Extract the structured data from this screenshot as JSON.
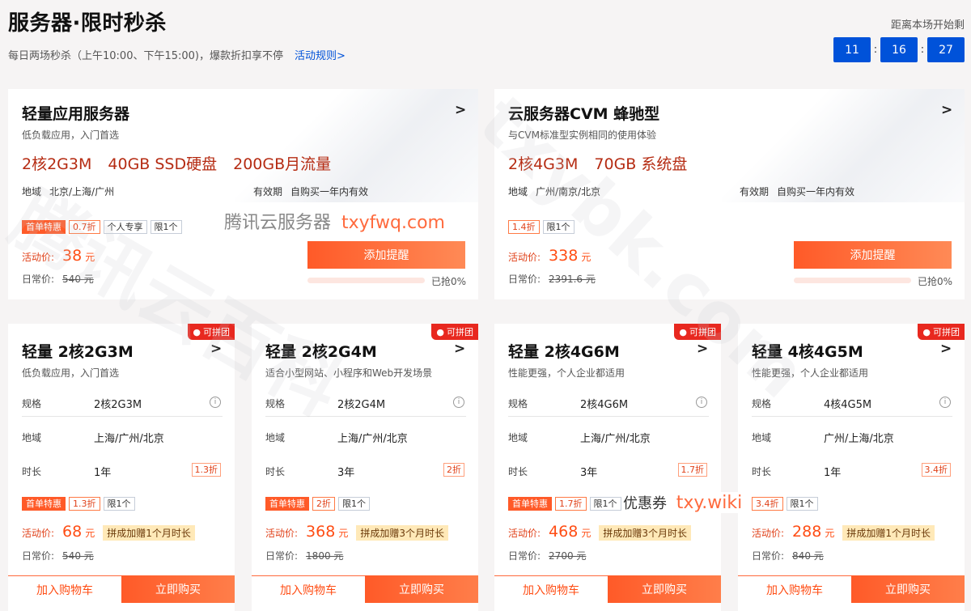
{
  "header": {
    "title": "服务器·限时秒杀",
    "subtitle": "每日两场秒杀（上午10:00、下午15:00)，爆款折扣享不停",
    "rules_link": "活动规则>",
    "countdown_label": "距离本场开始剩",
    "countdown": {
      "hours": "11",
      "minutes": "16",
      "seconds": "27",
      "separator": ":"
    }
  },
  "top_cards": [
    {
      "title": "轻量应用服务器",
      "chevron": ">",
      "desc": "低负载应用，入门首选",
      "specs": [
        "2核2G3M",
        "40GB SSD硬盘",
        "200GB月流量"
      ],
      "region_label": "地域",
      "region": "北京/上海/广州",
      "validity_label": "有效期",
      "validity": "自购买一年内有效",
      "tags": [
        {
          "text": "首单特惠",
          "style": "hot"
        },
        {
          "text": "0.7折",
          "style": "disc"
        },
        {
          "text": "个人专享",
          "style": "plain"
        },
        {
          "text": "限1个",
          "style": "plain"
        }
      ],
      "price_label": "活动价:",
      "price": "38",
      "price_unit": "元",
      "orig_label": "日常价:",
      "orig_price": "540 元",
      "remind_button": "添加提醒",
      "progress_pct": 0,
      "progress_text": "0%",
      "sold_text": "已抢0%"
    },
    {
      "title": "云服务器CVM 蜂驰型",
      "chevron": ">",
      "desc": "与CVM标准型实例相同的使用体验",
      "specs": [
        "2核4G3M",
        "70GB 系统盘"
      ],
      "region_label": "地域",
      "region": "广州/南京/北京",
      "validity_label": "有效期",
      "validity": "自购买一年内有效",
      "tags": [
        {
          "text": "1.4折",
          "style": "disc"
        },
        {
          "text": "限1个",
          "style": "plain"
        }
      ],
      "price_label": "活动价:",
      "price": "338",
      "price_unit": "元",
      "orig_label": "日常价:",
      "orig_price": "2391.6 元",
      "remind_button": "添加提醒",
      "progress_pct": 0,
      "progress_text": "0%",
      "sold_text": "已抢0%"
    }
  ],
  "bottom_cards": [
    {
      "badge": "可拼团",
      "title": "轻量 2核2G3M",
      "chevron": ">",
      "desc": "低负载应用，入门首选",
      "spec_label": "规格",
      "spec": "2核2G3M",
      "region_label": "地域",
      "region": "上海/广州/北京",
      "duration_label": "时长",
      "duration": "1年",
      "duration_disc": "1.3折",
      "tags": [
        {
          "text": "首单特惠",
          "style": "hot"
        },
        {
          "text": "1.3折",
          "style": "disc"
        },
        {
          "text": "限1个",
          "style": "plain"
        }
      ],
      "price_label": "活动价:",
      "price": "68",
      "price_unit": "元",
      "gift": "拼成加赠1个月时长",
      "orig_label": "日常价:",
      "orig_price": "540 元",
      "cart_button": "加入购物车",
      "buy_button": "立即购买"
    },
    {
      "badge": "可拼团",
      "title": "轻量 2核2G4M",
      "chevron": ">",
      "desc": "适合小型网站、小程序和Web开发场景",
      "spec_label": "规格",
      "spec": "2核2G4M",
      "region_label": "地域",
      "region": "上海/广州/北京",
      "duration_label": "时长",
      "duration": "3年",
      "duration_disc": "2折",
      "tags": [
        {
          "text": "首单特惠",
          "style": "hot"
        },
        {
          "text": "2折",
          "style": "disc"
        },
        {
          "text": "限1个",
          "style": "plain"
        }
      ],
      "price_label": "活动价:",
      "price": "368",
      "price_unit": "元",
      "gift": "拼成加赠3个月时长",
      "orig_label": "日常价:",
      "orig_price": "1800 元",
      "cart_button": "加入购物车",
      "buy_button": "立即购买"
    },
    {
      "badge": "可拼团",
      "title": "轻量 2核4G6M",
      "chevron": ">",
      "desc": "性能更强，个人企业都适用",
      "spec_label": "规格",
      "spec": "2核4G6M",
      "region_label": "地域",
      "region": "上海/广州/北京",
      "duration_label": "时长",
      "duration": "3年",
      "duration_disc": "1.7折",
      "tags": [
        {
          "text": "首单特惠",
          "style": "hot"
        },
        {
          "text": "1.7折",
          "style": "disc"
        },
        {
          "text": "限1个",
          "style": "plain"
        }
      ],
      "price_label": "活动价:",
      "price": "468",
      "price_unit": "元",
      "gift": "拼成加赠3个月时长",
      "orig_label": "日常价:",
      "orig_price": "2700 元",
      "cart_button": "加入购物车",
      "buy_button": "立即购买"
    },
    {
      "badge": "可拼团",
      "title": "轻量 4核4G5M",
      "chevron": ">",
      "desc": "性能更强，个人企业都适用",
      "spec_label": "规格",
      "spec": "4核4G5M",
      "region_label": "地域",
      "region": "广州/上海/北京",
      "duration_label": "时长",
      "duration": "1年",
      "duration_disc": "3.4折",
      "tags": [
        {
          "text": "3.4折",
          "style": "disc"
        },
        {
          "text": "限1个",
          "style": "plain"
        }
      ],
      "price_label": "活动价:",
      "price": "288",
      "price_unit": "元",
      "gift": "拼成加赠1个月时长",
      "orig_label": "日常价:",
      "orig_price": "840 元",
      "cart_button": "加入购物车",
      "buy_button": "立即购买"
    }
  ],
  "overlays": {
    "site_a_cn": "腾讯云服务器",
    "site_a_en": "txyfwq.com",
    "coupon_cn": "优惠券",
    "coupon_en": "txy.wiki",
    "watermark_cn": "腾讯云百科",
    "watermark_en": "txybk.com"
  },
  "icons": {
    "info": "info-circle-icon",
    "group": "group-buy-icon",
    "chevron": "chevron-right-icon"
  },
  "colors": {
    "brand_blue": "#0052d9",
    "accent_orange": "#ff5a28",
    "price_red": "#ff4d14"
  }
}
